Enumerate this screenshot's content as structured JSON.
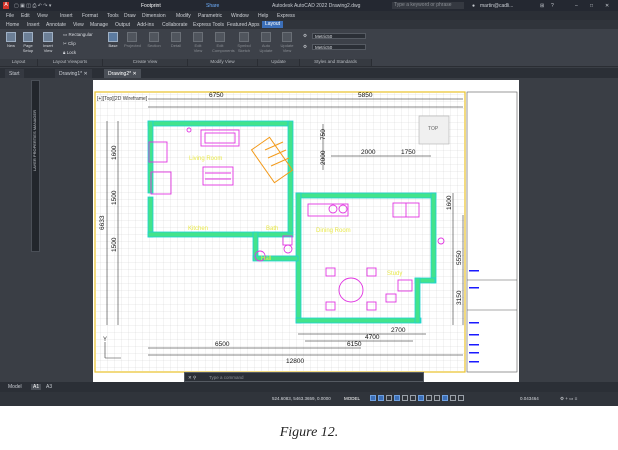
{
  "app": {
    "title": "Autodesk AutoCAD 2022   Drawing2.dwg",
    "workspace": "Footprint",
    "share_label": "Share",
    "search_placeholder": "Type a keyword or phrase",
    "user": "martin@cadli...",
    "window_controls": [
      "minimize-icon",
      "maximize-icon",
      "close-icon"
    ]
  },
  "menu": [
    "File",
    "Edit",
    "View",
    "Insert",
    "Format",
    "Tools",
    "Draw",
    "Dimension",
    "Modify",
    "Parametric",
    "Window",
    "Help",
    "Express"
  ],
  "ribbon_tabs": [
    "Home",
    "Insert",
    "Annotate",
    "View",
    "Manage",
    "Output",
    "Add-ins",
    "Collaborate",
    "Express Tools",
    "Featured Apps",
    "Layout"
  ],
  "ribbon_active_tab": "Layout",
  "ribbon": {
    "layout_buttons": [
      "New",
      "Page Setup"
    ],
    "viewport_items": [
      "Rectangular",
      "Clip",
      "Lock"
    ],
    "insert_view": "Insert View",
    "create_view": [
      "Base",
      "Projected",
      "Section",
      "Detail"
    ],
    "modify_view": [
      "Edit View",
      "Edit Components",
      "Symbol Sketch",
      "Auto Update",
      "Update View"
    ],
    "update_label": "Update",
    "styles": [
      "Metric50",
      "Metric50"
    ],
    "sections": [
      "Layout",
      "Layout Viewports",
      "Create View",
      "Modify View",
      "Update",
      "Styles and Standards"
    ]
  },
  "doc_tabs": [
    "Start",
    "Drawing1*",
    "Drawing2*"
  ],
  "active_doc_tab": "Drawing2*",
  "viewport": {
    "label": "[+][Top][2D Wireframe]",
    "viewcube_label": "TOP",
    "palette_label": "LAYER PROPERTIES MANAGER"
  },
  "plan": {
    "dims_top": [
      "6750",
      "5850"
    ],
    "dims_inner": [
      "2000",
      "1750"
    ],
    "dims_left": [
      "6633",
      "1600",
      "1500",
      "1500"
    ],
    "dims_right": [
      "1600",
      "5550",
      "3150"
    ],
    "dims_bottom": [
      "2700",
      "4700",
      "6150",
      "6500",
      "12800"
    ],
    "dims_small": [
      "750",
      "2000"
    ],
    "rooms": [
      "Living Room",
      "Kitchen",
      "Dining Room",
      "Bath",
      "Hall",
      "Study"
    ],
    "axis_label": "Y"
  },
  "command": {
    "placeholder": "Type a command"
  },
  "layout_tabs": [
    "Model",
    "A1",
    "A3"
  ],
  "active_layout_tab": "A1",
  "status": {
    "coords": "524.6083, 5463.3659, 0.0000",
    "mode": "MODEL",
    "scale": "0.043464"
  },
  "caption": "Figure 12.",
  "colors": {
    "accent": "#3c6fb8",
    "wall_fill": "#43e38c",
    "wall_outline": "#1ed3d3",
    "furniture": "#e135e1",
    "dimension": "#111111",
    "border": "#e8c12a",
    "room_text": "#e9e94a",
    "grid": "#c8c8c8"
  }
}
